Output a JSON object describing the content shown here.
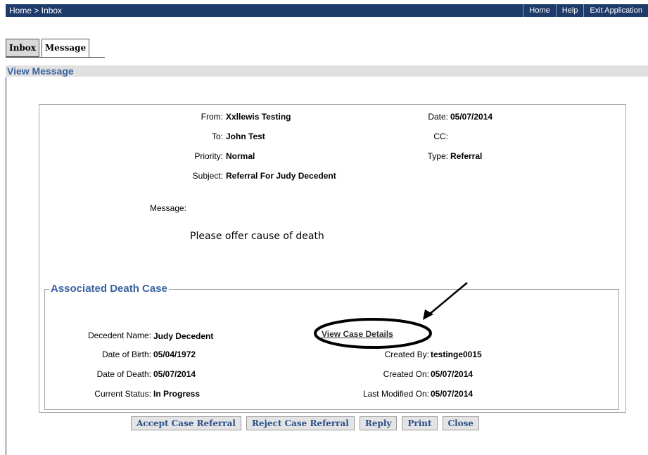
{
  "breadcrumb": "Home > Inbox",
  "top_nav": [
    "Home",
    "Help",
    "Exit Application"
  ],
  "tabs": [
    {
      "label": "Inbox"
    },
    {
      "label": "Message"
    }
  ],
  "section_title": "View Message",
  "message": {
    "from_label": "From:",
    "from_value": "Xxllewis Testing",
    "date_label": "Date:",
    "date_value": "05/07/2014",
    "to_label": "To:",
    "to_value": "John Test",
    "cc_label": "CC:",
    "cc_value": "",
    "priority_label": "Priority:",
    "priority_value": "Normal",
    "type_label": "Type:",
    "type_value": "Referral",
    "subject_label": "Subject:",
    "subject_value": "Referral For Judy Decedent",
    "message_label": "Message:",
    "body": "Please offer cause of death"
  },
  "death_case": {
    "legend": "Associated Death Case",
    "decedent_name_label": "Decedent Name:",
    "decedent_name_value": "Judy Decedent",
    "dob_label": "Date of Birth:",
    "dob_value": "05/04/1972",
    "dod_label": "Date of Death:",
    "dod_value": "05/07/2014",
    "status_label": "Current Status:",
    "status_value": "In Progress",
    "view_link": "View Case Details",
    "created_by_label": "Created By:",
    "created_by_value": "testinge0015",
    "created_on_label": "Created On:",
    "created_on_value": "05/07/2014",
    "modified_label": "Last Modified On:",
    "modified_value": "05/07/2014"
  },
  "buttons": {
    "accept": "Accept Case Referral",
    "reject": "Reject Case Referral",
    "reply": "Reply",
    "print": "Print",
    "close": "Close"
  },
  "colors": {
    "nav_bar": "#1f3b6b",
    "title_text": "#3b63a0",
    "button_text": "#2a4f8a"
  }
}
